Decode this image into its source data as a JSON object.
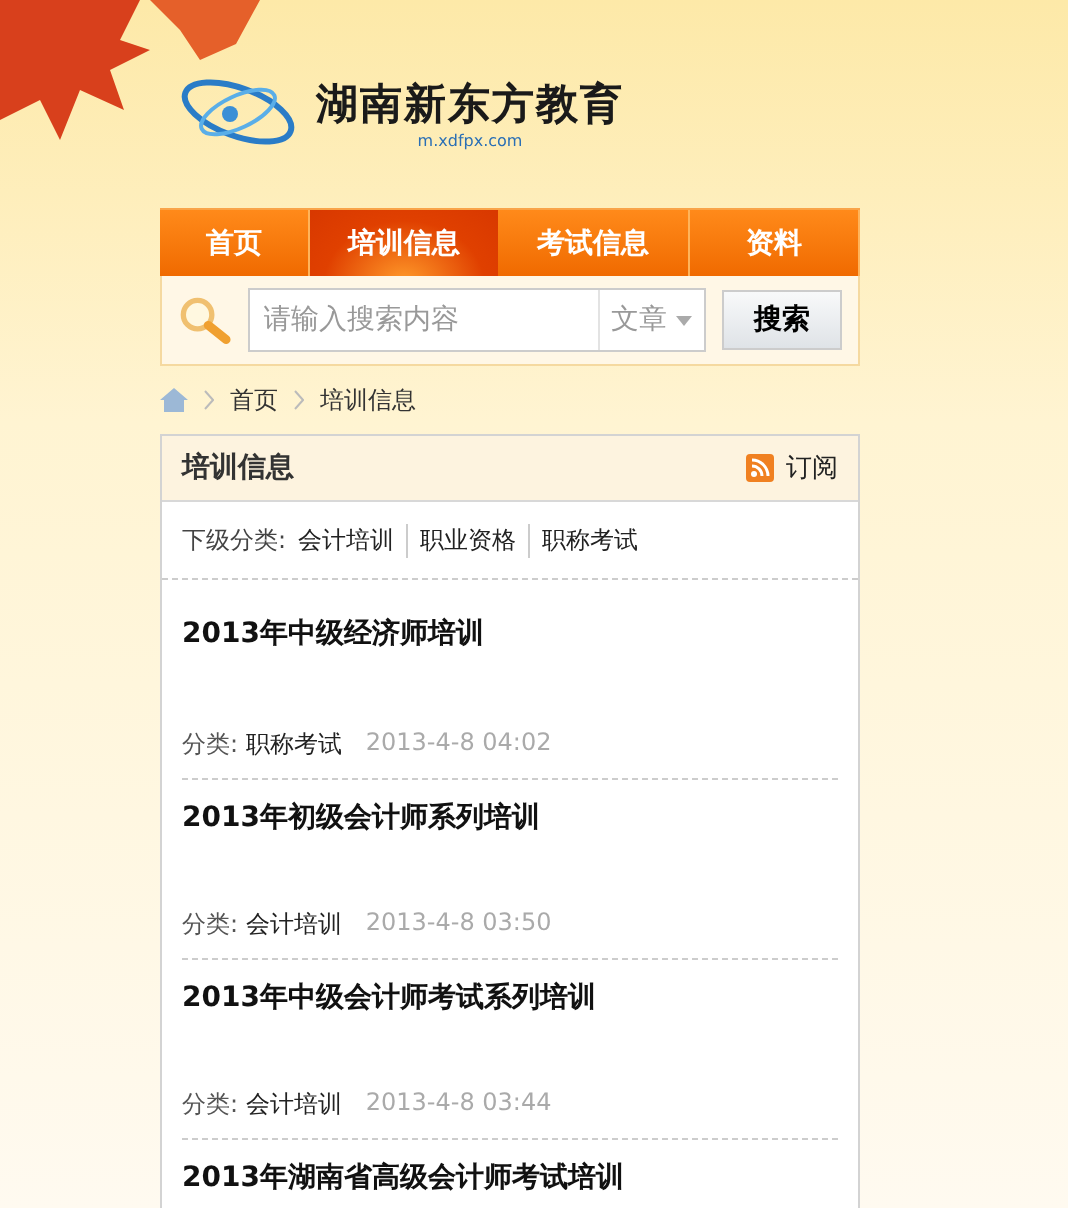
{
  "logo": {
    "name": "湖南新东方教育",
    "url": "m.xdfpx.com"
  },
  "nav": [
    {
      "label": "首页",
      "selected": false
    },
    {
      "label": "培训信息",
      "selected": true
    },
    {
      "label": "考试信息",
      "selected": false
    },
    {
      "label": "资料",
      "selected": false
    }
  ],
  "search": {
    "placeholder": "请输入搜索内容",
    "scope": "文章",
    "button": "搜索"
  },
  "breadcrumb": [
    "首页",
    "培训信息"
  ],
  "panel": {
    "title": "培训信息",
    "subscribe": "订阅",
    "subcategory_label": "下级分类:",
    "subcategories": [
      "会计培训",
      "职业资格",
      "职称考试"
    ],
    "items": [
      {
        "title": "2013年中级经济师培训",
        "category_label": "分类:",
        "category": "职称考试",
        "date": "2013-4-8 04:02"
      },
      {
        "title": "2013年初级会计师系列培训",
        "category_label": "分类:",
        "category": "会计培训",
        "date": "2013-4-8 03:50"
      },
      {
        "title": "2013年中级会计师考试系列培训",
        "category_label": "分类:",
        "category": "会计培训",
        "date": "2013-4-8 03:44"
      },
      {
        "title": "2013年湖南省高级会计师考试培训"
      }
    ]
  }
}
